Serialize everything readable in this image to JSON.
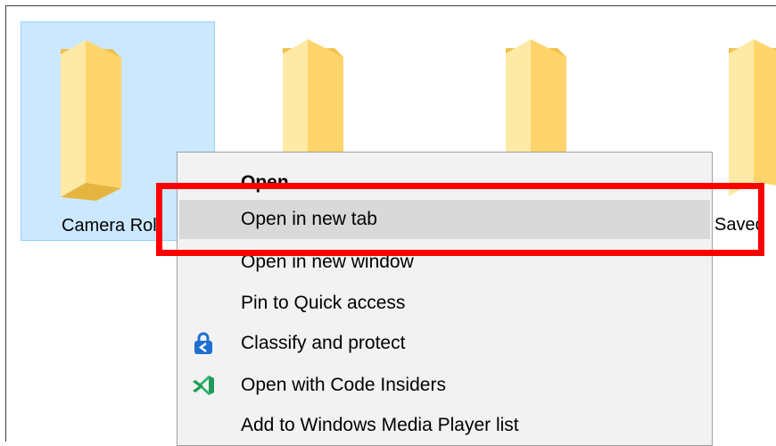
{
  "folders": [
    {
      "label": "Camera Roll",
      "selected": true,
      "icon": "folder-icon"
    },
    {
      "label": "",
      "selected": false,
      "icon": "folder-icon"
    },
    {
      "label": "",
      "selected": false,
      "icon": "folder-icon"
    },
    {
      "label": "Saved",
      "selected": false,
      "icon": "folder-icon"
    }
  ],
  "context_menu": {
    "items": [
      {
        "label": "Open",
        "bold": true
      },
      {
        "label": "Open in new tab",
        "hover": true
      },
      {
        "label": "Open in new window"
      },
      {
        "label": "Pin to Quick access"
      },
      {
        "label": "Classify and protect",
        "icon": "lock-shield-icon"
      },
      {
        "label": "Open with Code Insiders",
        "icon": "vscode-insiders-icon"
      },
      {
        "label": "Add to Windows Media Player list"
      }
    ]
  },
  "colors": {
    "selection_bg": "#cce8ff",
    "selection_border": "#99d1ff",
    "menu_bg": "#f2f2f2",
    "hover_bg": "#d9d9d9",
    "highlight": "#ff0000",
    "folder_front": "#ffd56b",
    "folder_back": "#f0c14a"
  }
}
